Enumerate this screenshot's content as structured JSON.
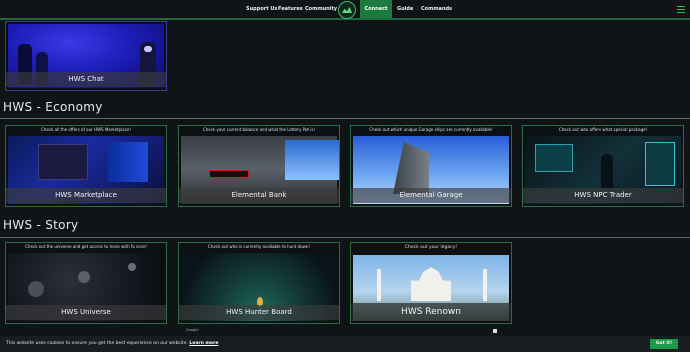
{
  "nav": {
    "items": [
      "Support Us",
      "Features",
      "Community"
    ],
    "active": "Connect",
    "after": [
      "Guide",
      "Commands"
    ]
  },
  "chat": {
    "label": "HWS Chat"
  },
  "economy": {
    "title": "HWS - Economy",
    "tiles": [
      {
        "caption": "Check all the offers of our HWS Marketplace!",
        "label": "HWS Marketplace"
      },
      {
        "caption": "Check your current balance and what the Lottery Pot is!",
        "label": "Elemental Bank"
      },
      {
        "caption": "Check out which unique Garage ships are currently available!",
        "label": "Elemental Garage"
      },
      {
        "caption": "Check out who offers what special package!",
        "label": "HWS NPC Trader"
      }
    ]
  },
  "story": {
    "title": "HWS - Story",
    "tiles": [
      {
        "caption": "Check out the universe and get access to more with fa scan!",
        "label": "HWS Universe"
      },
      {
        "caption": "Check out who is currently available to hunt down!",
        "label": "HWS Hunter Board"
      },
      {
        "caption": "Check out your legacy!",
        "label": "HWS Renown"
      }
    ]
  },
  "google": "Google",
  "cookie": {
    "text": "This website uses cookies to ensure you get the best experience on our website.",
    "link": "Learn more",
    "button": "Got it!"
  }
}
